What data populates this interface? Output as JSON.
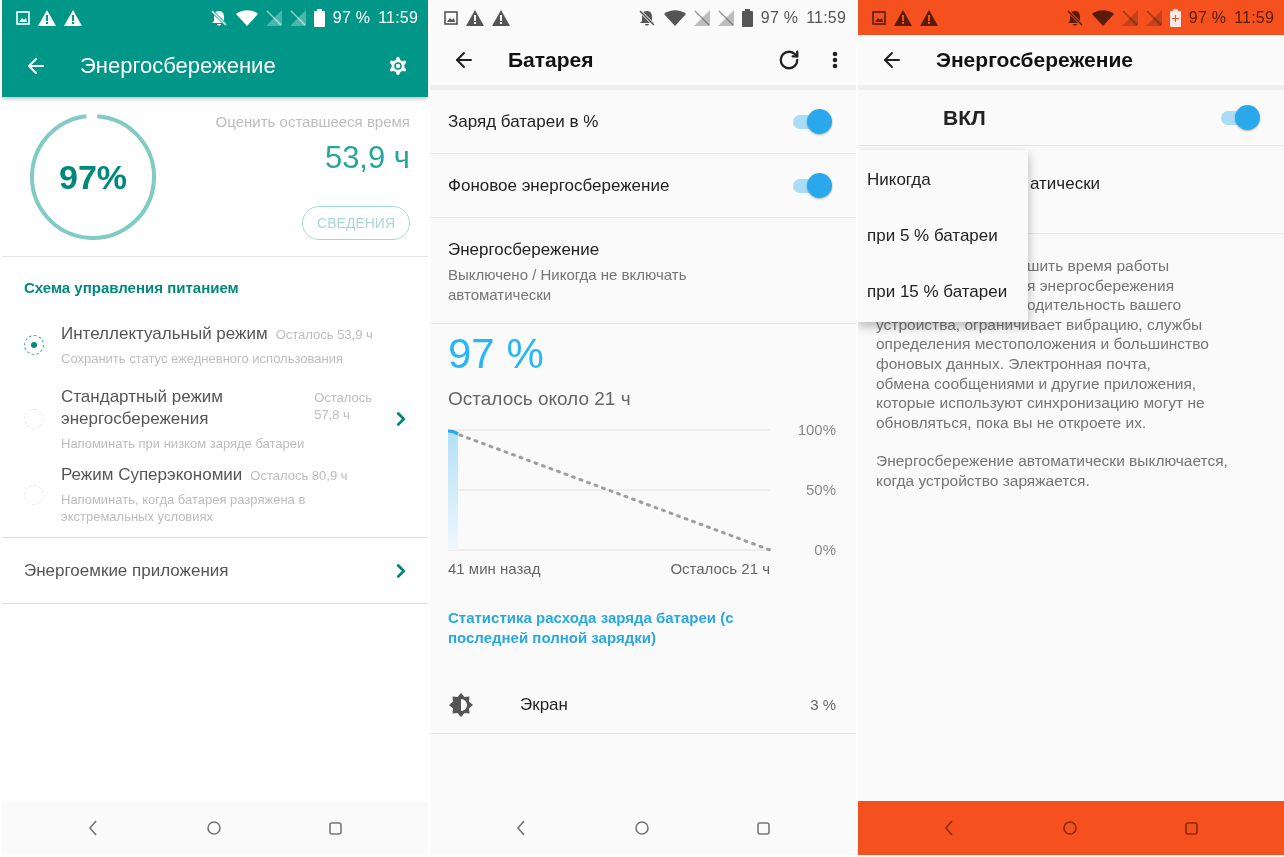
{
  "power_manager": {
    "status_bar": {
      "battery": "97 %",
      "time": "11:59",
      "charging": false
    },
    "title": "Энергосбережение",
    "gauge": {
      "value": "97%",
      "level": 0.97
    },
    "estimate": {
      "label": "Оценить оставшееся время",
      "value": "53,9 ч"
    },
    "details_button": "СВЕДЕНИЯ",
    "section_title": "Схема управления питанием",
    "modes": [
      {
        "title": "Интеллектуальный режим",
        "remaining": "Осталось 53,9 ч",
        "subtitle": "Сохранить статус ежедневного использования",
        "selected": true,
        "expandable": false
      },
      {
        "title": "Стандартный режим энергосбережения",
        "remaining": "Осталось 57,8 ч",
        "subtitle": "Напоминать при низком заряде батареи",
        "selected": false,
        "expandable": true
      },
      {
        "title": "Режим Суперэкономии",
        "remaining": "Осталось 80,9 ч",
        "subtitle": "Напоминать, когда батарея разряжена в экстремальных условиях",
        "selected": false,
        "expandable": false
      }
    ],
    "apps_row": "Энергоемкие приложения"
  },
  "battery": {
    "status_bar": {
      "battery": "97 %",
      "time": "11:59",
      "charging": false
    },
    "title": "Батарея",
    "switches": [
      {
        "label": "Заряд батареи в %",
        "on": true
      },
      {
        "label": "Фоновое энергосбережение",
        "on": true
      }
    ],
    "saver_item": {
      "title": "Энергосбережение",
      "summary": "Выключено / Никогда не включать автоматически"
    },
    "level_text": "97 %",
    "remaining": "Осталось около 21 ч",
    "chart": {
      "y_labels": [
        "100%",
        "50%",
        "0%"
      ],
      "x_labels": [
        "41 мин назад",
        "Осталось 21 ч"
      ]
    },
    "stats_header": "Статистика расхода заряда батареи (с последней полной зарядки)",
    "usage": [
      {
        "label": "Экран",
        "value": "3 %"
      }
    ]
  },
  "battery_saver": {
    "status_bar": {
      "battery": "97 %",
      "time": "11:59",
      "charging": true
    },
    "title": "Энергосбережение",
    "master_switch": {
      "label": "ВКЛ",
      "on": true
    },
    "schedule_fragment": "атически",
    "description_fragments": [
      "шить время работы",
      "я энергосбережения",
      "одительность вашего"
    ],
    "description_lines": [
      "устройства, ограничивает вибрацию, службы",
      "определения местоположения и большинство",
      "фоновых данных. Электронная почта,",
      "обмена сообщениями и другие приложения,",
      "которые используют синхронизацию могут не",
      "обновляться, пока вы не откроете их."
    ],
    "footer": "Энергосбережение автоматически выключается, когда устройство заряжается.",
    "menu": [
      {
        "label": "Никогда"
      },
      {
        "label": "при 5 % батареи"
      },
      {
        "label": "при 15 % батареи"
      }
    ]
  }
}
